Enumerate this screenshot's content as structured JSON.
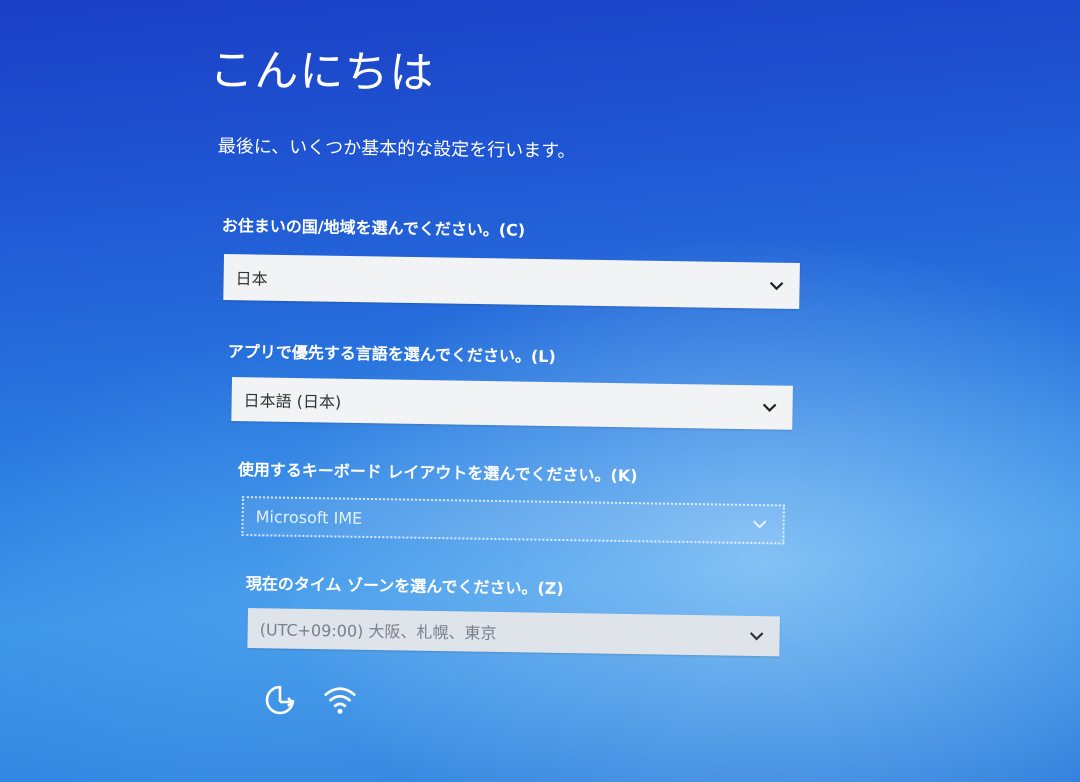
{
  "header": {
    "title": "こんにちは",
    "subtitle": "最後に、いくつか基本的な設定を行います。"
  },
  "fields": [
    {
      "label": "お住まいの国/地域を選んでください。(C)",
      "value": "日本"
    },
    {
      "label": "アプリで優先する言語を選んでください。(L)",
      "value": "日本語 (日本)"
    },
    {
      "label": "使用するキーボード レイアウトを選んでください。(K)",
      "value": "Microsoft IME"
    },
    {
      "label": "現在のタイム ゾーンを選んでください。(Z)",
      "value": "(UTC+09:00) 大阪、札幌、東京"
    }
  ],
  "bottom_bar": {
    "icons": [
      "ease-of-access-icon",
      "wifi-icon"
    ]
  },
  "colors": {
    "background_top": "#1a3fc4",
    "background_bottom": "#3c95e8",
    "dropdown_bg": "#f1f3f5",
    "text": "#ffffff"
  }
}
